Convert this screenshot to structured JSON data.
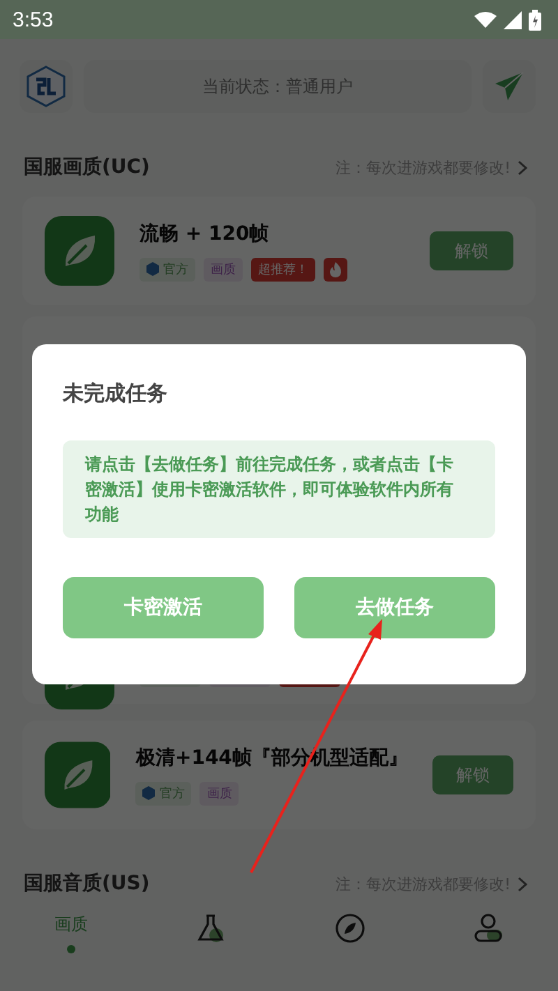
{
  "status_bar": {
    "time": "3:53"
  },
  "header": {
    "status_text": "当前状态：普通用户"
  },
  "sections": [
    {
      "title": "国服画质(UC)",
      "note": "注：每次进游戏都要修改!",
      "cards": [
        {
          "kind": "full",
          "title": "流畅 + 120帧",
          "tags": [
            {
              "kind": "official",
              "label": "官方"
            },
            {
              "kind": "quality",
              "label": "画质"
            },
            {
              "kind": "hot",
              "label": "超推荐！"
            },
            {
              "kind": "fire"
            }
          ],
          "button": "解锁"
        },
        {
          "kind": "hidden",
          "tags": [
            {
              "kind": "official"
            },
            {
              "kind": "quality"
            },
            {
              "kind": "hot"
            }
          ]
        },
        {
          "kind": "full",
          "title": "极清+144帧『部分机型适配』",
          "tags": [
            {
              "kind": "official",
              "label": "官方"
            },
            {
              "kind": "quality",
              "label": "画质"
            }
          ],
          "button": "解锁"
        }
      ]
    },
    {
      "title": "国服音质(US)",
      "note": "注：每次进游戏都要修改!"
    }
  ],
  "bottom_nav": [
    {
      "kind": "text",
      "label": "画质",
      "selected": true
    },
    {
      "kind": "flask",
      "selected": false
    },
    {
      "kind": "compass",
      "selected": false
    },
    {
      "kind": "user",
      "selected": false
    }
  ],
  "dialog": {
    "title": "未完成任务",
    "message": "请点击【去做任务】前往完成任务，或者点击【卡密激活】使用卡密激活软件，即可体验软件内所有功能",
    "buttons": [
      "卡密激活",
      "去做任务"
    ]
  },
  "annotation": {
    "kind": "arrow"
  }
}
